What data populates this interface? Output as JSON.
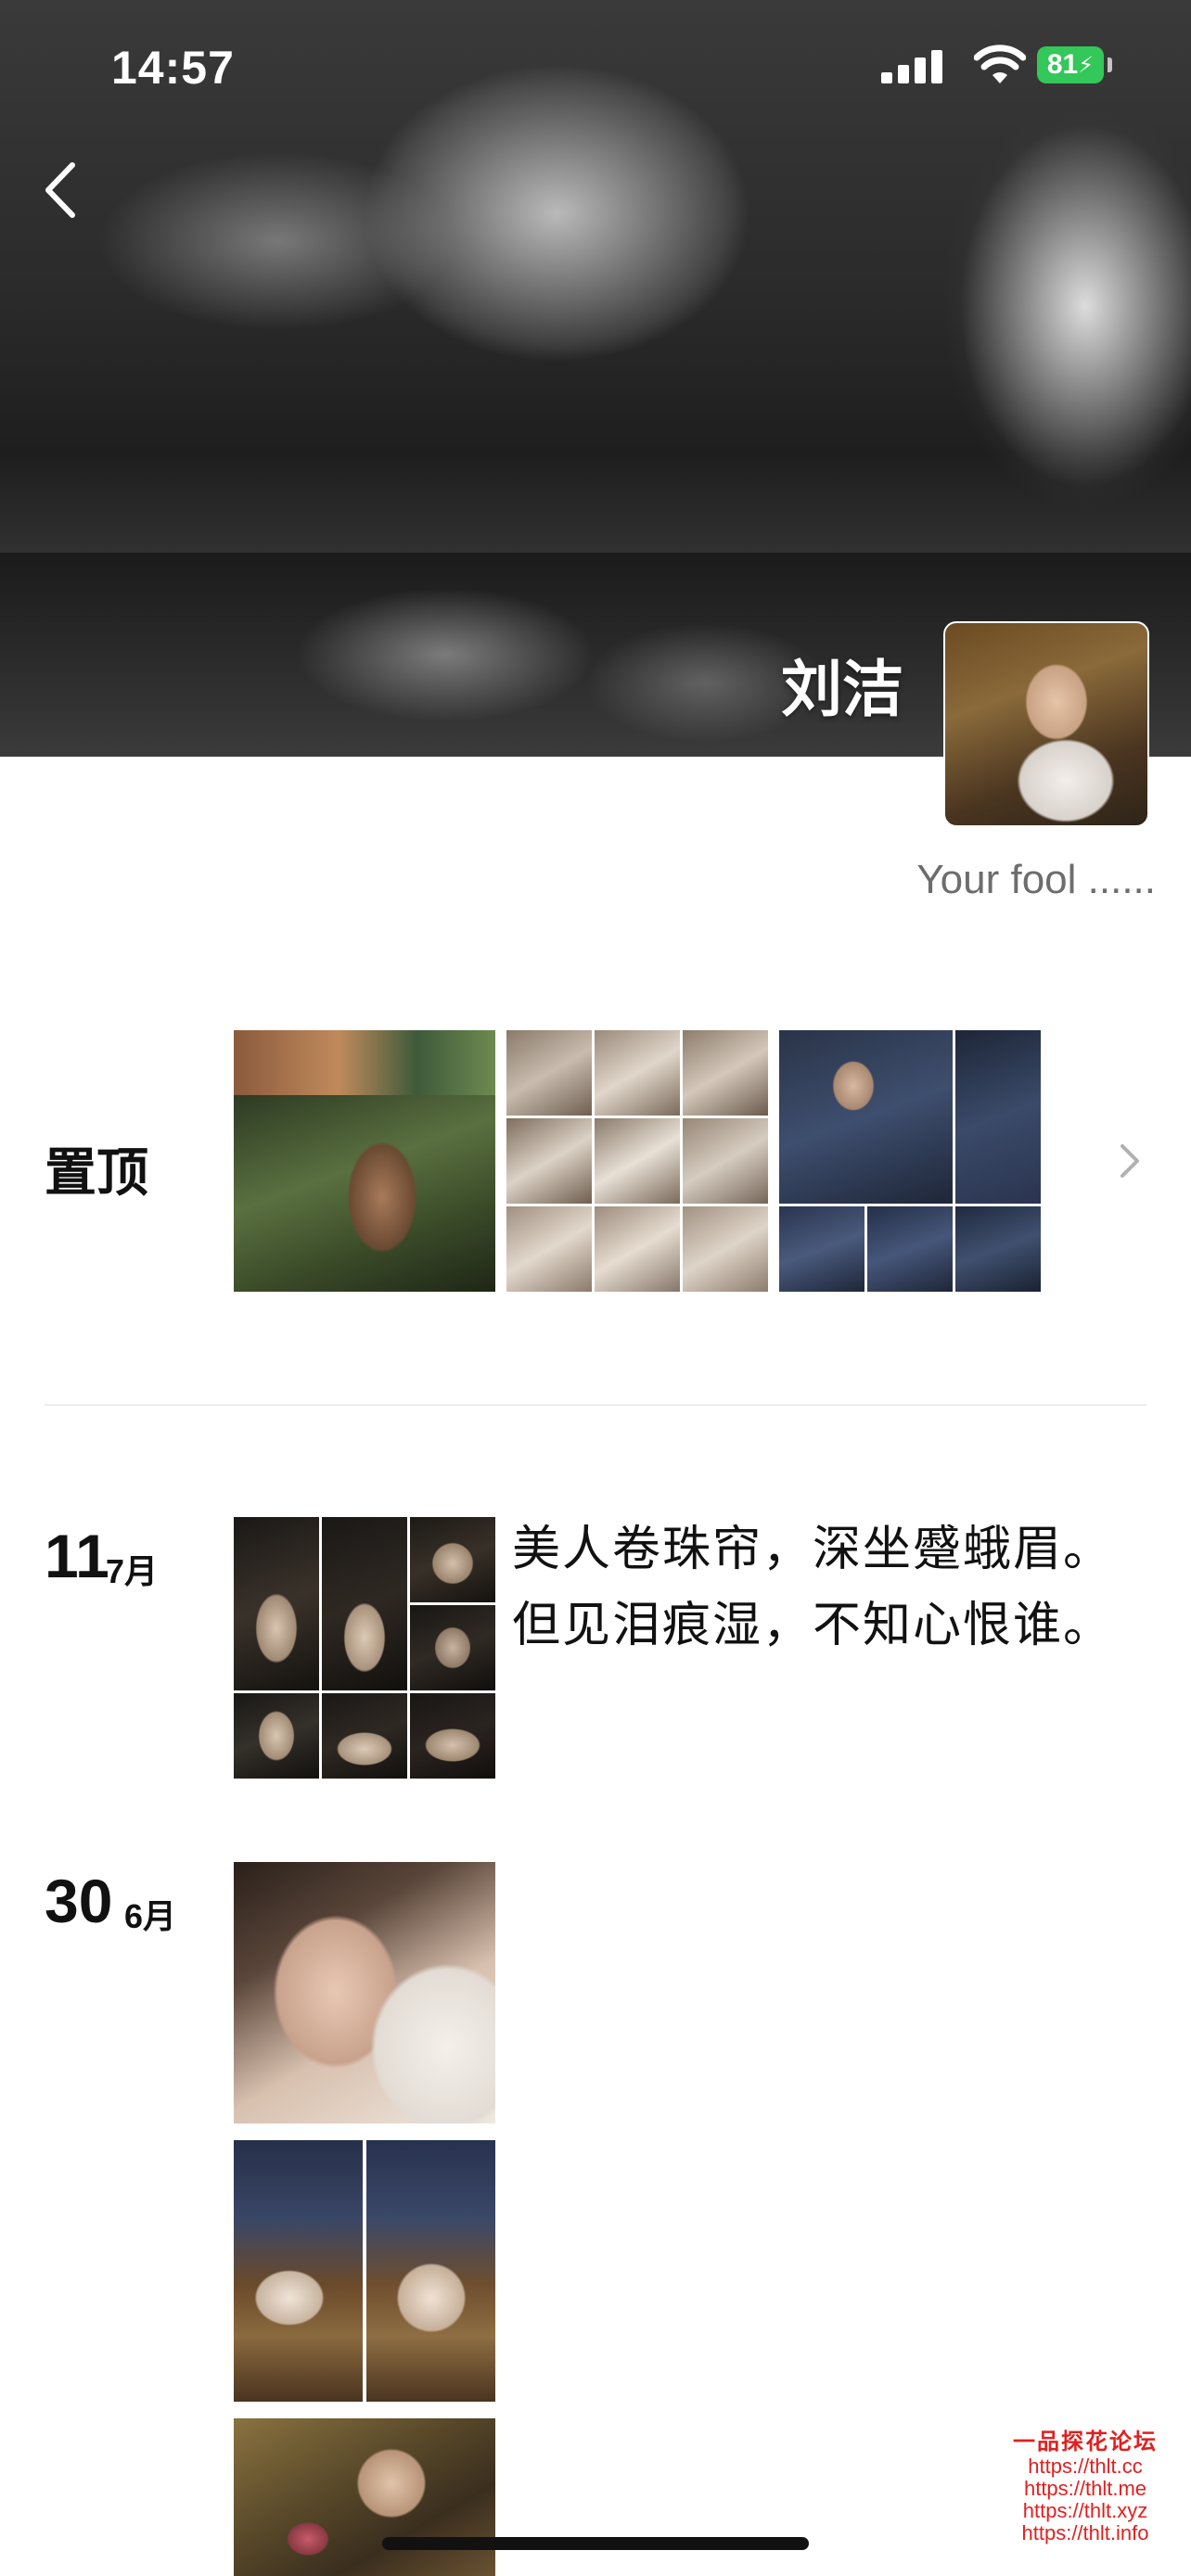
{
  "status_bar": {
    "time": "14:57",
    "battery": "81"
  },
  "profile": {
    "name": "刘洁",
    "signature": "Your fool ......"
  },
  "pinned": {
    "label": "置顶"
  },
  "posts": [
    {
      "day": "11",
      "month": "7月",
      "text_line1": "美人卷珠帘，深坐蹙蛾眉。",
      "text_line2": "但见泪痕湿，不知心恨谁。"
    },
    {
      "day": "30",
      "month": "6月"
    }
  ],
  "watermark": {
    "title": "一品探花论坛",
    "lines": [
      "https://thlt.cc",
      "https://thlt.me",
      "https://thlt.xyz",
      "https://thlt.info"
    ]
  },
  "colors": {
    "battery": "#34c759",
    "watermark": "#e02020"
  }
}
